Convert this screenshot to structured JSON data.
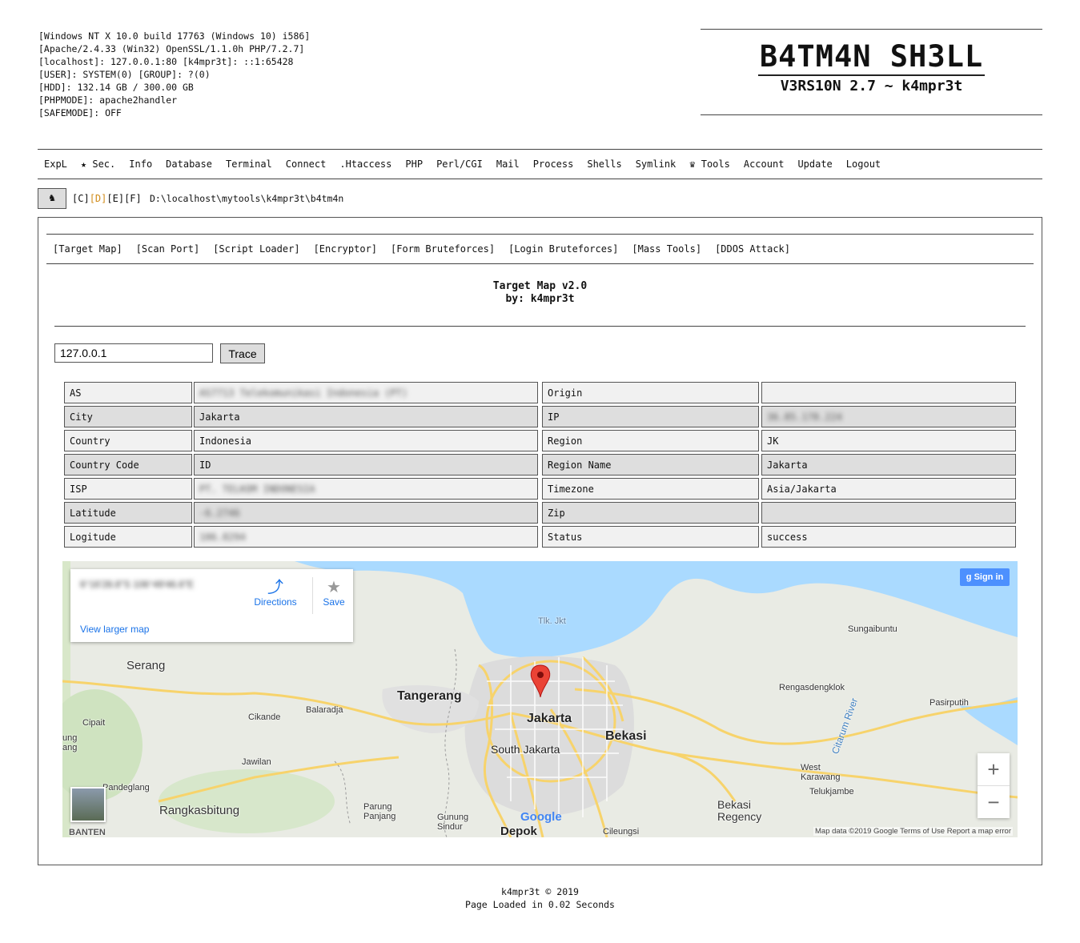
{
  "sysinfo": [
    "[Windows NT X 10.0 build 17763 (Windows 10) i586]",
    "[Apache/2.4.33 (Win32) OpenSSL/1.1.0h PHP/7.2.7]",
    "[localhost]: 127.0.0.1:80 [k4mpr3t]: ::1:65428",
    "[USER]: SYSTEM(0) [GROUP]: ?(0)",
    "[HDD]: 132.14 GB / 300.00 GB",
    "[PHPMODE]: apache2handler",
    "[SAFEMODE]: OFF"
  ],
  "brand": {
    "title": "B4TM4N SH3LL",
    "subtitle": "V3RS10N 2.7 ~ k4mpr3t"
  },
  "nav": [
    "ExpL",
    "★ Sec.",
    "Info",
    "Database",
    "Terminal",
    "Connect",
    ".Htaccess",
    "PHP",
    "Perl/CGI",
    "Mail",
    "Process",
    "Shells",
    "Symlink",
    "♛ Tools",
    "Account",
    "Update",
    "Logout"
  ],
  "pathbar": {
    "home_icon": "♞",
    "drives": [
      "[C]",
      "[D]",
      "[E]",
      "[F]"
    ],
    "cwd": "D:\\localhost\\mytools\\k4mpr3t\\b4tm4n"
  },
  "tools": [
    "[Target Map]",
    "[Scan Port]",
    "[Script Loader]",
    "[Encryptor]",
    "[Form Bruteforces]",
    "[Login Bruteforces]",
    "[Mass Tools]",
    "[DDOS Attack]"
  ],
  "tool": {
    "title": "Target Map v2.0",
    "byline": "by: k4mpr3t"
  },
  "trace": {
    "ip": "127.0.0.1",
    "button": "Trace"
  },
  "info_rows": [
    {
      "l1": "AS",
      "v1": "AS7713 Telekomunikasi Indonesia (PT)",
      "b1": true,
      "l2": "Origin",
      "v2": "",
      "b2": false
    },
    {
      "l1": "City",
      "v1": "Jakarta",
      "b1": false,
      "l2": "IP",
      "v2": "36.85.178.224",
      "b2": true
    },
    {
      "l1": "Country",
      "v1": "Indonesia",
      "b1": false,
      "l2": "Region",
      "v2": "JK",
      "b2": false
    },
    {
      "l1": "Country Code",
      "v1": "ID",
      "b1": false,
      "l2": "Region Name",
      "v2": "Jakarta",
      "b2": false
    },
    {
      "l1": "ISP",
      "v1": "PT. TELKOM INDONESIA",
      "b1": true,
      "l2": "Timezone",
      "v2": "Asia/Jakarta",
      "b2": false
    },
    {
      "l1": "Latitude",
      "v1": "-6.2746",
      "b1": true,
      "l2": "Zip",
      "v2": "",
      "b2": false
    },
    {
      "l1": "Logitude",
      "v1": "106.8294",
      "b1": true,
      "l2": "Status",
      "v2": "success",
      "b2": false
    }
  ],
  "map": {
    "coords": "6°16'28.8\"S 106°49'46.6\"E",
    "directions": "Directions",
    "save": "Save",
    "view_larger": "View larger map",
    "sign_in": "Sign in",
    "zoom_in": "+",
    "zoom_out": "−",
    "footer": "Map data ©2019 Google   Terms of Use   Report a map error",
    "google": "Google",
    "labels": {
      "tlk_jkt": "Tlk. Jkt",
      "serang": "Serang",
      "tangerang": "Tangerang",
      "jakarta": "Jakarta",
      "south_jakarta": "South Jakarta",
      "bekasi": "Bekasi",
      "balaradja": "Balaradja",
      "cikande": "Cikande",
      "cipait": "Cipait",
      "jawilan": "Jawilan",
      "pandeglang": "Pandeglang",
      "rangkasbitung": "Rangkasbitung",
      "banten": "BANTEN",
      "parung_panjang": "Parung\nPanjang",
      "gunung_sindur": "Gunung\nSindur",
      "depok": "Depok",
      "cileungsi": "Cileungsi",
      "sungaibuntu": "Sungaibuntu",
      "rengasdengklok": "Rengasdengklok",
      "pasirputih": "Pasirputih",
      "citarum": "Citarum River",
      "west_karawang": "West\nKarawang",
      "telukjambe": "Telukjambe",
      "bekasi_regency": "Bekasi\nRegency",
      "ung_ang": "ung\nang"
    }
  },
  "footer": {
    "line1": "k4mpr3t © 2019",
    "line2": "Page Loaded in 0.02 Seconds"
  },
  "colors": {
    "accent_drive": "#d08a17",
    "water": "#aadaff",
    "road": "#f7d36b",
    "link": "#1a73e8"
  }
}
